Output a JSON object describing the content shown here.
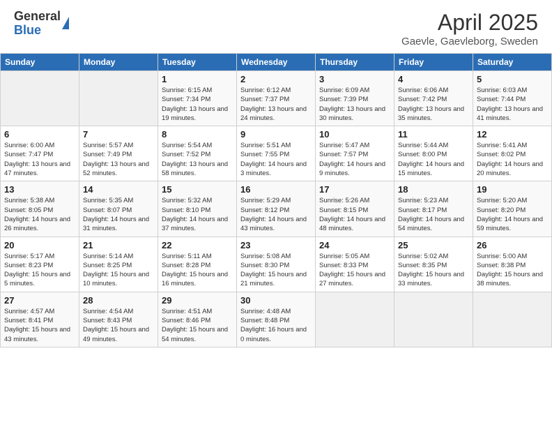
{
  "header": {
    "logo_general": "General",
    "logo_blue": "Blue",
    "title": "April 2025",
    "location": "Gaevle, Gaevleborg, Sweden"
  },
  "weekdays": [
    "Sunday",
    "Monday",
    "Tuesday",
    "Wednesday",
    "Thursday",
    "Friday",
    "Saturday"
  ],
  "weeks": [
    [
      {
        "day": "",
        "info": ""
      },
      {
        "day": "",
        "info": ""
      },
      {
        "day": "1",
        "info": "Sunrise: 6:15 AM\nSunset: 7:34 PM\nDaylight: 13 hours and 19 minutes."
      },
      {
        "day": "2",
        "info": "Sunrise: 6:12 AM\nSunset: 7:37 PM\nDaylight: 13 hours and 24 minutes."
      },
      {
        "day": "3",
        "info": "Sunrise: 6:09 AM\nSunset: 7:39 PM\nDaylight: 13 hours and 30 minutes."
      },
      {
        "day": "4",
        "info": "Sunrise: 6:06 AM\nSunset: 7:42 PM\nDaylight: 13 hours and 35 minutes."
      },
      {
        "day": "5",
        "info": "Sunrise: 6:03 AM\nSunset: 7:44 PM\nDaylight: 13 hours and 41 minutes."
      }
    ],
    [
      {
        "day": "6",
        "info": "Sunrise: 6:00 AM\nSunset: 7:47 PM\nDaylight: 13 hours and 47 minutes."
      },
      {
        "day": "7",
        "info": "Sunrise: 5:57 AM\nSunset: 7:49 PM\nDaylight: 13 hours and 52 minutes."
      },
      {
        "day": "8",
        "info": "Sunrise: 5:54 AM\nSunset: 7:52 PM\nDaylight: 13 hours and 58 minutes."
      },
      {
        "day": "9",
        "info": "Sunrise: 5:51 AM\nSunset: 7:55 PM\nDaylight: 14 hours and 3 minutes."
      },
      {
        "day": "10",
        "info": "Sunrise: 5:47 AM\nSunset: 7:57 PM\nDaylight: 14 hours and 9 minutes."
      },
      {
        "day": "11",
        "info": "Sunrise: 5:44 AM\nSunset: 8:00 PM\nDaylight: 14 hours and 15 minutes."
      },
      {
        "day": "12",
        "info": "Sunrise: 5:41 AM\nSunset: 8:02 PM\nDaylight: 14 hours and 20 minutes."
      }
    ],
    [
      {
        "day": "13",
        "info": "Sunrise: 5:38 AM\nSunset: 8:05 PM\nDaylight: 14 hours and 26 minutes."
      },
      {
        "day": "14",
        "info": "Sunrise: 5:35 AM\nSunset: 8:07 PM\nDaylight: 14 hours and 31 minutes."
      },
      {
        "day": "15",
        "info": "Sunrise: 5:32 AM\nSunset: 8:10 PM\nDaylight: 14 hours and 37 minutes."
      },
      {
        "day": "16",
        "info": "Sunrise: 5:29 AM\nSunset: 8:12 PM\nDaylight: 14 hours and 43 minutes."
      },
      {
        "day": "17",
        "info": "Sunrise: 5:26 AM\nSunset: 8:15 PM\nDaylight: 14 hours and 48 minutes."
      },
      {
        "day": "18",
        "info": "Sunrise: 5:23 AM\nSunset: 8:17 PM\nDaylight: 14 hours and 54 minutes."
      },
      {
        "day": "19",
        "info": "Sunrise: 5:20 AM\nSunset: 8:20 PM\nDaylight: 14 hours and 59 minutes."
      }
    ],
    [
      {
        "day": "20",
        "info": "Sunrise: 5:17 AM\nSunset: 8:23 PM\nDaylight: 15 hours and 5 minutes."
      },
      {
        "day": "21",
        "info": "Sunrise: 5:14 AM\nSunset: 8:25 PM\nDaylight: 15 hours and 10 minutes."
      },
      {
        "day": "22",
        "info": "Sunrise: 5:11 AM\nSunset: 8:28 PM\nDaylight: 15 hours and 16 minutes."
      },
      {
        "day": "23",
        "info": "Sunrise: 5:08 AM\nSunset: 8:30 PM\nDaylight: 15 hours and 21 minutes."
      },
      {
        "day": "24",
        "info": "Sunrise: 5:05 AM\nSunset: 8:33 PM\nDaylight: 15 hours and 27 minutes."
      },
      {
        "day": "25",
        "info": "Sunrise: 5:02 AM\nSunset: 8:35 PM\nDaylight: 15 hours and 33 minutes."
      },
      {
        "day": "26",
        "info": "Sunrise: 5:00 AM\nSunset: 8:38 PM\nDaylight: 15 hours and 38 minutes."
      }
    ],
    [
      {
        "day": "27",
        "info": "Sunrise: 4:57 AM\nSunset: 8:41 PM\nDaylight: 15 hours and 43 minutes."
      },
      {
        "day": "28",
        "info": "Sunrise: 4:54 AM\nSunset: 8:43 PM\nDaylight: 15 hours and 49 minutes."
      },
      {
        "day": "29",
        "info": "Sunrise: 4:51 AM\nSunset: 8:46 PM\nDaylight: 15 hours and 54 minutes."
      },
      {
        "day": "30",
        "info": "Sunrise: 4:48 AM\nSunset: 8:48 PM\nDaylight: 16 hours and 0 minutes."
      },
      {
        "day": "",
        "info": ""
      },
      {
        "day": "",
        "info": ""
      },
      {
        "day": "",
        "info": ""
      }
    ]
  ]
}
